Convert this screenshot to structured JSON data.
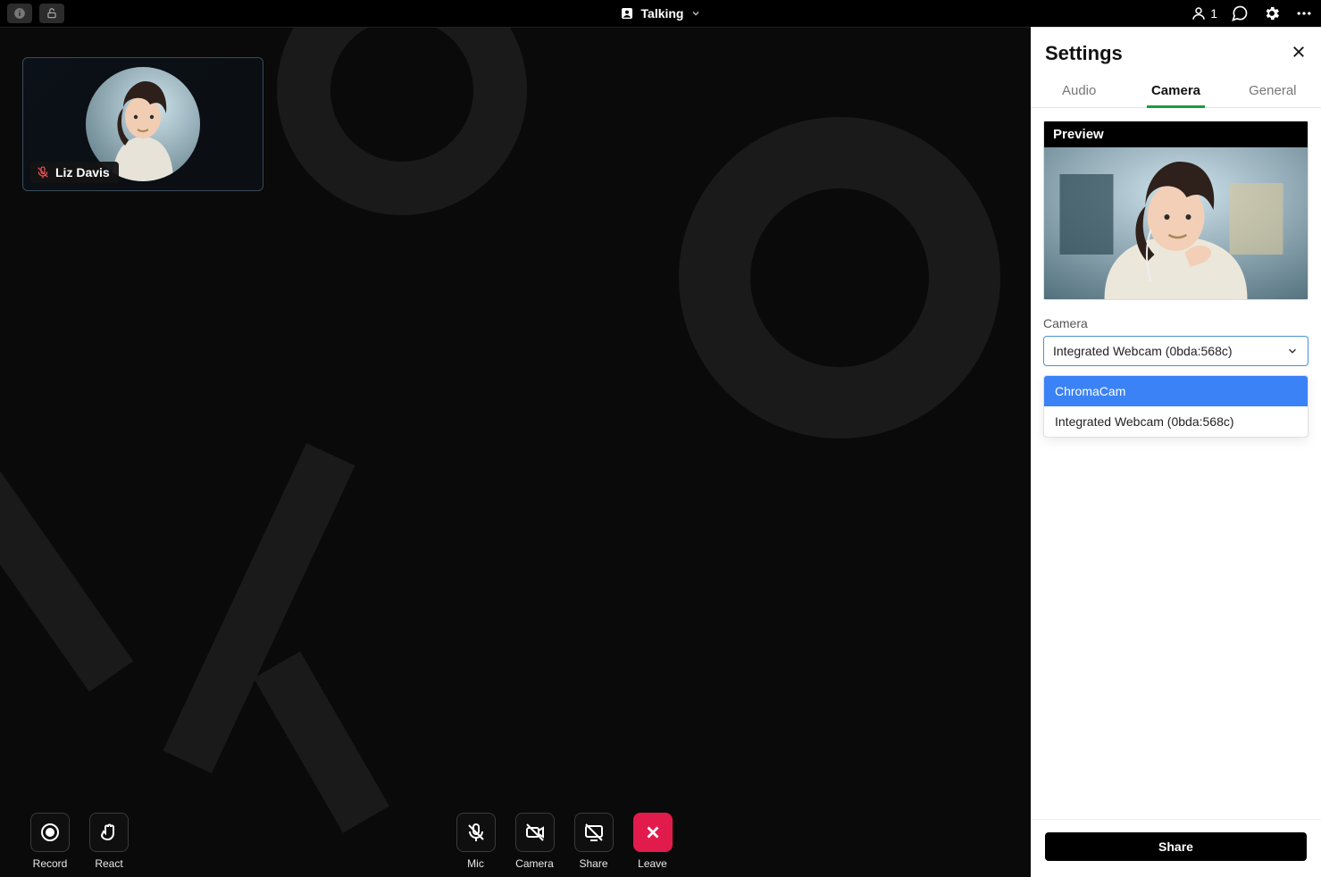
{
  "topbar": {
    "status_label": "Talking",
    "participant_count": "1"
  },
  "participant": {
    "name": "Liz Davis",
    "mic_muted_icon": "mic-muted-icon"
  },
  "dock": {
    "record": "Record",
    "react": "React",
    "mic": "Mic",
    "camera": "Camera",
    "share": "Share",
    "leave": "Leave"
  },
  "settings": {
    "title": "Settings",
    "tabs": {
      "audio": "Audio",
      "camera": "Camera",
      "general": "General"
    },
    "active_tab": "camera",
    "preview_label": "Preview",
    "camera_field_label": "Camera",
    "camera_selected": "Integrated Webcam (0bda:568c)",
    "camera_options": [
      "ChromaCam",
      "Integrated Webcam (0bda:568c)"
    ],
    "camera_highlighted_index": 0,
    "share_button": "Share"
  }
}
